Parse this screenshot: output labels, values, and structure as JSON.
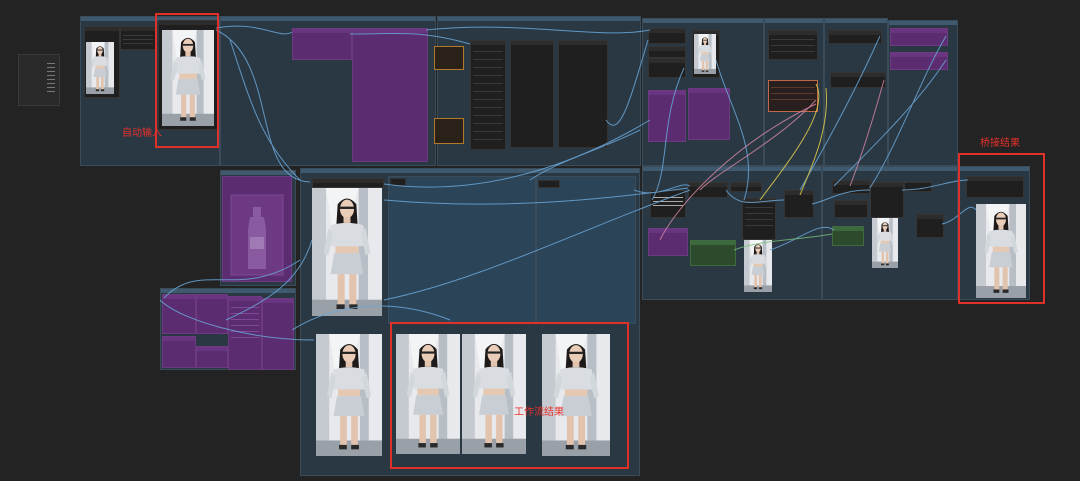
{
  "annotations": {
    "auto_input": "自动输入",
    "workflow_result": "工作流结果",
    "bridge_result": "桥接结果"
  },
  "colors": {
    "canvas": "#232323",
    "group": "#2a3844",
    "purple_node": "#5b2c6f",
    "green_node": "#2d4a2d",
    "highlight_red": "#e0302a",
    "link_blue": "#6aa7d8",
    "link_yellow": "#d8c64a",
    "link_pink": "#d88aa8",
    "link_green": "#7ac07a"
  },
  "icons": {
    "preview_image": "person-photo-icon",
    "bottle_image": "bottle-icon"
  }
}
